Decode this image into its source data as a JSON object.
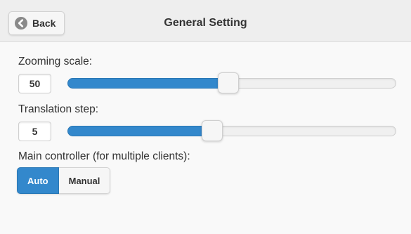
{
  "header": {
    "back_label": "Back",
    "back_icon": "back-arrow-icon",
    "title": "General Setting"
  },
  "settings": {
    "zoom": {
      "label": "Zooming scale:",
      "value": "50",
      "slider_fraction": 0.49
    },
    "translation": {
      "label": "Translation step:",
      "value": "5",
      "slider_fraction": 0.44
    },
    "controller": {
      "label": "Main controller (for multiple clients):",
      "options": [
        "Auto",
        "Manual"
      ],
      "selected": "Auto"
    }
  },
  "colors": {
    "accent": "#3388cc"
  }
}
